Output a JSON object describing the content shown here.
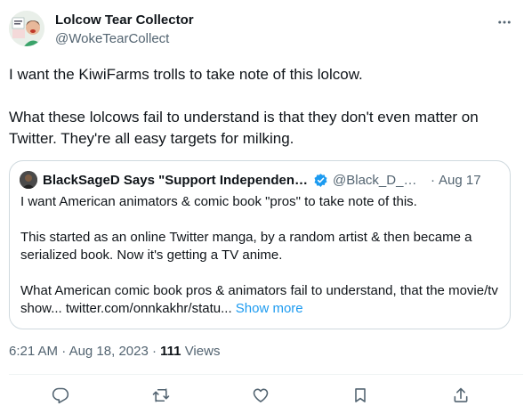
{
  "tweet": {
    "author_name": "Lolcow Tear Collector",
    "author_handle": "@WokeTearCollect",
    "paragraph_1": "I want the KiwiFarms trolls to take note of this lolcow.",
    "paragraph_2": "What these lolcows fail to understand is that they don't even matter on Twitter. They're all easy targets for milking.",
    "time": "6:21 AM",
    "date": "Aug 18, 2023",
    "views_count": "111",
    "views_label": "Views"
  },
  "quote": {
    "author_name": "BlackSageD Says \"Support Independent M...",
    "author_handle": "@Black_D_Ga...",
    "separator": "·",
    "date": "Aug 17",
    "paragraph_1": "I want American animators & comic book \"pros\" to take note of this.",
    "paragraph_2": "This started as an online Twitter manga, by a random artist & then became a serialized book. Now it's getting a TV anime.",
    "paragraph_3": "What American comic book pros & animators fail to understand, that the movie/tv show... twitter.com/onnkakhr/statu...",
    "show_more": "Show more"
  },
  "meta_separator": "·",
  "actions": [
    "reply-icon",
    "retweet-icon",
    "like-icon",
    "bookmark-icon",
    "share-icon"
  ],
  "colors": {
    "text": "#0f1419",
    "secondary": "#536471",
    "accent": "#1d9bf0",
    "border": "#cfd9de"
  }
}
